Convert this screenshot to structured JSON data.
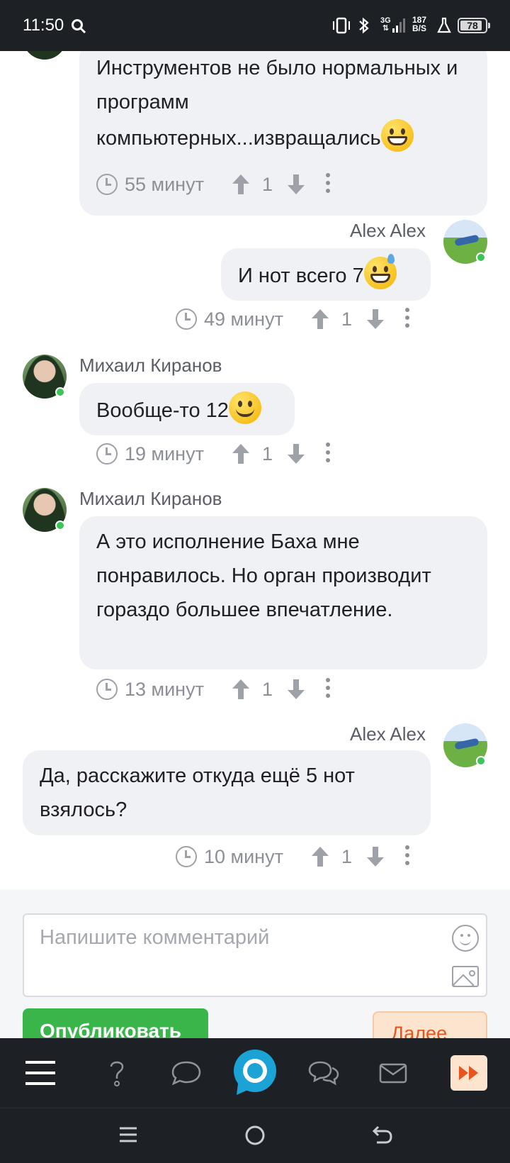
{
  "status_bar": {
    "time": "11:50",
    "network": "3G",
    "speed_value": "187",
    "speed_unit": "B/S",
    "battery": "78"
  },
  "comments": [
    {
      "side": "left",
      "text": "Инструментов не было нормальных и программ компьютерных...извращались",
      "emoji": "grinning-face",
      "time_ago": "55 минут",
      "votes": "1"
    },
    {
      "side": "right",
      "author": "Alex Alex",
      "text": "И нот всего 7",
      "emoji": "grinning-sweat-face",
      "time_ago": "49 минут",
      "votes": "1"
    },
    {
      "side": "left",
      "author": "Михаил Киранов",
      "text": "Вообще-то 12",
      "emoji": "slightly-smiling-face",
      "time_ago": "19 минут",
      "votes": "1"
    },
    {
      "side": "left",
      "author": "Михаил Киранов",
      "text": "А это исполнение Баха мне понравилось. Но орган производит гораздо большее впечатление.",
      "time_ago": "13 минут",
      "votes": "1"
    },
    {
      "side": "right",
      "author": "Alex Alex",
      "text": "Да, расскажите откуда ещё 5 нот взялось?",
      "time_ago": "10 минут",
      "votes": "1"
    }
  ],
  "composer": {
    "placeholder": "Напишите комментарий",
    "publish_label": "Опубликовать",
    "next_label": "Далее"
  },
  "tabbar": {
    "items": [
      "menu-icon",
      "help-icon",
      "comment-icon",
      "home-logo-icon",
      "chat-icon",
      "mail-icon",
      "fast-forward-icon"
    ]
  },
  "colors": {
    "accent_green": "#39b54a",
    "online": "#3cc45a",
    "bubble": "#f0f1f4",
    "dark_bar": "#1d2126",
    "next_orange": "#e8541e",
    "logo_blue": "#1aa3d4"
  }
}
